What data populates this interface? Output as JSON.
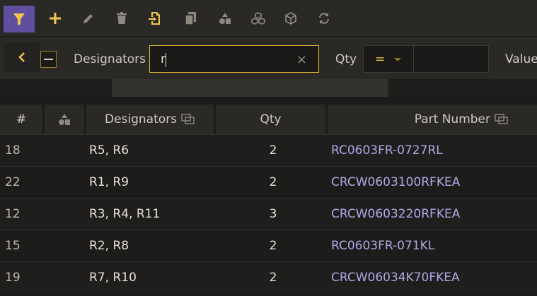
{
  "toolbar": {
    "buttons": [
      {
        "icon": "filter-icon",
        "active": true
      },
      {
        "icon": "plus-icon"
      },
      {
        "icon": "pencil-icon"
      },
      {
        "icon": "trash-icon"
      },
      {
        "icon": "import-icon"
      },
      {
        "icon": "copy-icon"
      },
      {
        "icon": "shapes-icon"
      },
      {
        "icon": "cubes-icon"
      },
      {
        "icon": "cube-icon"
      },
      {
        "icon": "swap-icon"
      }
    ]
  },
  "filters": {
    "designators_label": "Designators",
    "designators_value": "r",
    "clear_glyph": "×",
    "qty_label": "Qty",
    "qty_operator": "=",
    "qty_value": "",
    "value_label": "Value"
  },
  "table": {
    "headers": {
      "index": "#",
      "designators": "Designators",
      "qty": "Qty",
      "part_number": "Part Number"
    },
    "rows": [
      {
        "index": "18",
        "designators": "R5, R6",
        "qty": "2",
        "part_number": "RC0603FR-0727RL"
      },
      {
        "index": "22",
        "designators": "R1, R9",
        "qty": "2",
        "part_number": "CRCW0603100RFKEA"
      },
      {
        "index": "12",
        "designators": "R3, R4, R11",
        "qty": "3",
        "part_number": "CRCW0603220RFKEA"
      },
      {
        "index": "15",
        "designators": "R2, R8",
        "qty": "2",
        "part_number": "RC0603FR-071KL"
      },
      {
        "index": "19",
        "designators": "R7, R10",
        "qty": "2",
        "part_number": "CRCW06034K70FKEA"
      }
    ]
  },
  "colors": {
    "accent_yellow": "#f2c94c",
    "filter_active_bg": "#5f4f9e",
    "part_number_link": "#b3a6e6"
  }
}
